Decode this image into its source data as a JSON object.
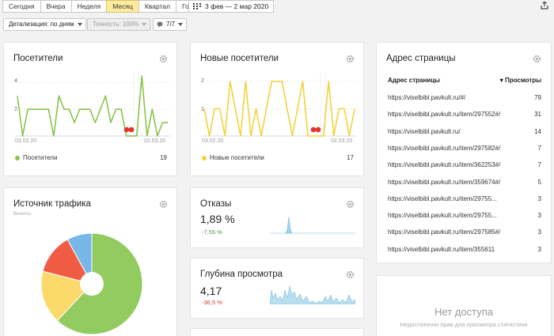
{
  "toolbar": {
    "periods": [
      "Сегодня",
      "Вчера",
      "Неделя",
      "Месяц",
      "Квартал",
      "Год"
    ],
    "active_period": "Месяц",
    "date_range": "3 фев — 2 мар 2020",
    "detail": "Детализация: по дням",
    "accuracy": "Точность: 100%",
    "segments": "7/7"
  },
  "visitors": {
    "title": "Посетители",
    "y_ticks": [
      "4",
      "2"
    ],
    "x_ticks": [
      "03.02.20",
      "02.03.20"
    ],
    "legend": "Посетители",
    "total": "19",
    "color": "#8bc34a"
  },
  "new_visitors": {
    "title": "Новые посетители",
    "y_ticks": [
      "2",
      "1"
    ],
    "x_ticks": [
      "03.02.20",
      "02.03.20"
    ],
    "legend": "Новые посетители",
    "total": "17",
    "color": "#f2d33d"
  },
  "pages": {
    "title": "Адрес страницы",
    "col_url": "Адрес страницы",
    "col_views": "▾ Просмотры",
    "rows": [
      {
        "url": "https://viselbibl.pavkult.ru/#/",
        "views": "79"
      },
      {
        "url": "https://viselbibl.pavkult.ru/item/297552#/",
        "views": "31"
      },
      {
        "url": "https://viselbibl.pavkult.ru/",
        "views": "14"
      },
      {
        "url": "https://viselbibl.pavkult.ru/item/297582#/",
        "views": "7"
      },
      {
        "url": "https://viselbibl.pavkult.ru/item/362253#/",
        "views": "7"
      },
      {
        "url": "https://viselbibl.pavkult.ru/item/359674#/",
        "views": "5"
      },
      {
        "url": "https://viselbibl.pavkult.ru/item/29755...",
        "views": "3"
      },
      {
        "url": "https://viselbibl.pavkult.ru/item/29755...",
        "views": "3"
      },
      {
        "url": "https://viselbibl.pavkult.ru/item/297585#/",
        "views": "3"
      },
      {
        "url": "https://viselbibl.pavkult.ru/item/355611",
        "views": "3"
      }
    ]
  },
  "traffic": {
    "title": "Источник трафика",
    "subtitle": "Визиты"
  },
  "bounce": {
    "title": "Отказы",
    "value": "1,89 %",
    "delta": "-7,55 %",
    "delta_color": "#4a9d3a"
  },
  "depth": {
    "title": "Глубина просмотра",
    "value": "4,17",
    "delta": "-36,5 %",
    "delta_color": "#d23a2a"
  },
  "no_access": {
    "title": "Нет доступа",
    "subtitle": "Недостаточно прав для просмотра статистики"
  },
  "chart_data": [
    {
      "type": "line",
      "title": "Посетители",
      "x_range": [
        "03.02.20",
        "02.03.20"
      ],
      "ylim": [
        0,
        4.5
      ],
      "series": [
        {
          "name": "Посетители",
          "values": [
            3,
            0,
            2,
            2,
            2,
            2,
            2,
            0,
            3,
            2,
            2,
            1,
            2,
            2,
            2,
            1,
            2,
            3,
            1,
            2,
            2,
            0,
            0,
            0,
            4.5,
            0,
            2,
            0,
            1,
            1
          ]
        }
      ]
    },
    {
      "type": "line",
      "title": "Новые посетители",
      "x_range": [
        "03.02.20",
        "02.03.20"
      ],
      "ylim": [
        0,
        2.2
      ],
      "series": [
        {
          "name": "Новые посетители",
          "values": [
            1,
            0,
            1,
            1,
            0,
            2,
            1,
            0,
            2,
            0,
            1,
            0,
            1,
            2,
            2,
            2,
            1,
            0,
            1,
            2,
            0,
            0,
            0,
            0,
            2,
            0,
            1,
            1,
            0,
            1
          ]
        }
      ]
    },
    {
      "type": "pie",
      "title": "Источник трафика",
      "values": [
        62,
        17,
        13,
        8
      ],
      "colors": [
        "#92cb5f",
        "#fbd96a",
        "#f05b43",
        "#76b7e8"
      ]
    }
  ]
}
